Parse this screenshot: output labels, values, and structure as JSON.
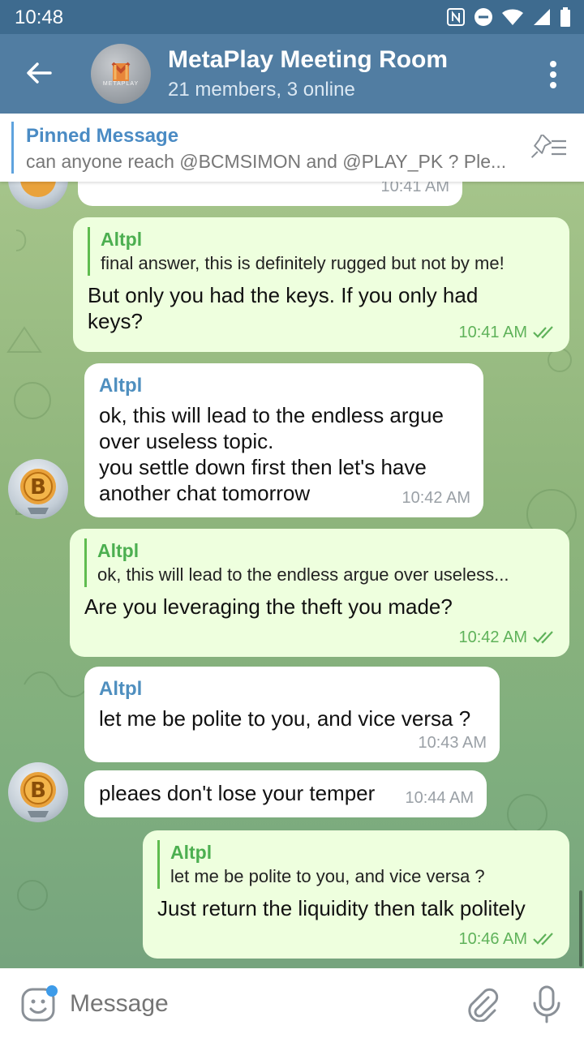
{
  "status_bar": {
    "time": "10:48"
  },
  "header": {
    "title": "MetaPlay Meeting Room",
    "subtitle": "21 members, 3 online",
    "avatar_label": "METAPLAY"
  },
  "pinned": {
    "title": "Pinned Message",
    "text": "can anyone reach @BCMSIMON  and @PLAY_PK ? Ple..."
  },
  "messages": [
    {
      "time": "10:41 AM"
    },
    {
      "reply_name": "Altpl",
      "reply_text": "final answer, this is definitely rugged but not by me!",
      "text": "But only you had the keys. If you only had keys?",
      "time": "10:41 AM"
    },
    {
      "name": "Altpl",
      "text": "ok, this will lead to the endless argue over useless topic.\nyou settle down first then let's have another chat tomorrow",
      "time": "10:42 AM"
    },
    {
      "reply_name": "Altpl",
      "reply_text": "ok, this will lead to the endless argue over useless...",
      "text": "Are you leveraging the theft you made?",
      "time": "10:42 AM"
    },
    {
      "name": "Altpl",
      "text": "let me be polite to you, and vice versa ?",
      "time": "10:43 AM"
    },
    {
      "text": "pleaes don't lose your temper",
      "time": "10:44 AM"
    },
    {
      "reply_name": "Altpl",
      "reply_text": "let me be polite to you, and vice versa ?",
      "text": "Just return the liquidity then talk politely",
      "time": "10:46 AM"
    }
  ],
  "input": {
    "placeholder": "Message"
  },
  "colors": {
    "appbar": "#517da2",
    "incoming_bubble": "#ffffff",
    "outgoing_bubble": "#eeffde",
    "accent_green": "#4caf50"
  }
}
